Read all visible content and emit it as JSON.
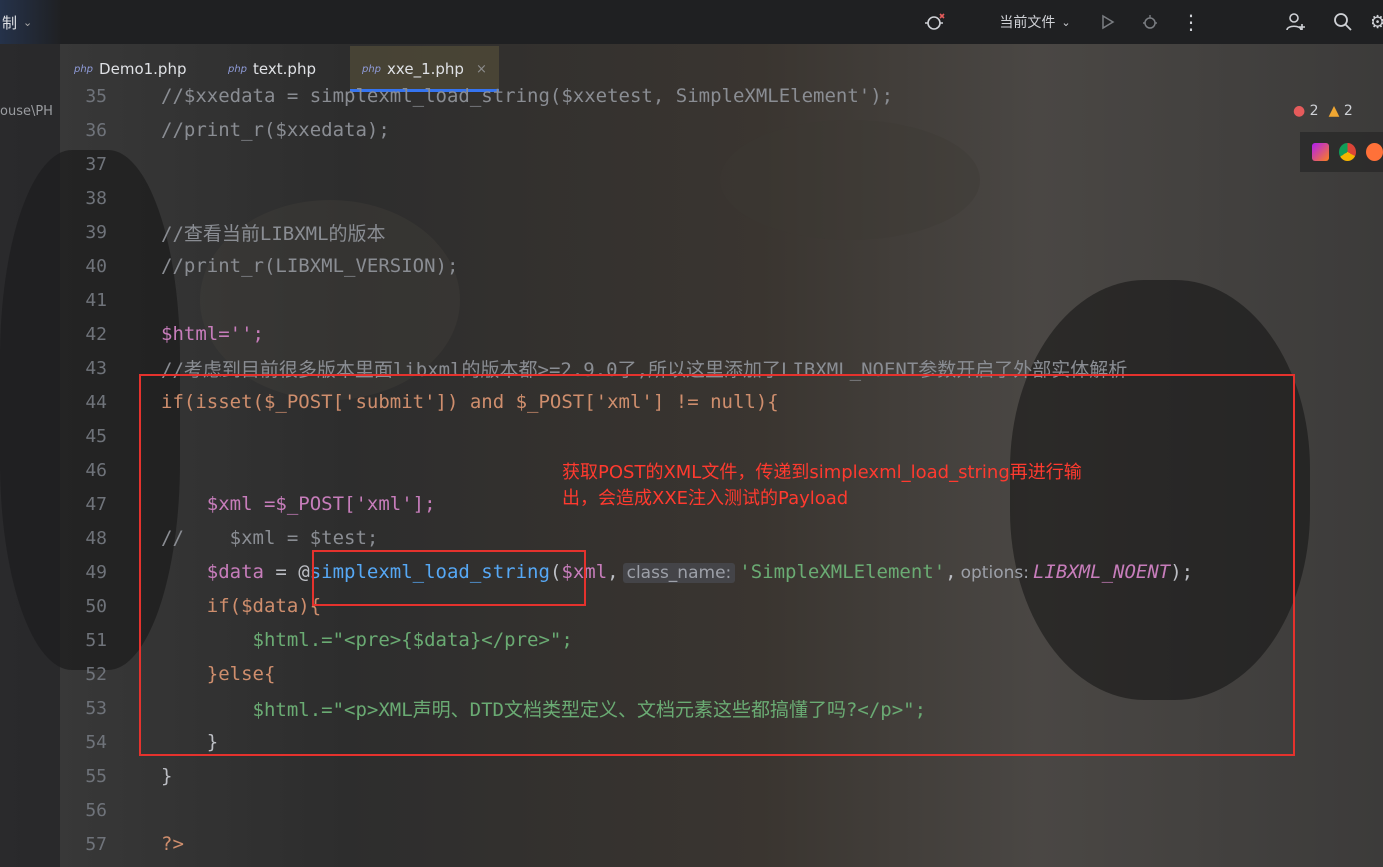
{
  "toolbar": {
    "left_label": "制",
    "run_config": "当前文件",
    "colors": {
      "bg": "#1f2022",
      "accent": "#3574f0"
    }
  },
  "tabs": [
    {
      "icon": "php",
      "label": "Demo1.php",
      "active": false
    },
    {
      "icon": "php",
      "label": "text.php",
      "active": false
    },
    {
      "icon": "php",
      "label": "xxe_1.php",
      "active": true,
      "close": "×"
    }
  ],
  "side_path": "ouse\\PH",
  "inspections": {
    "errors": "2",
    "warnings": "2"
  },
  "code_lines": [
    {
      "num": "35",
      "text": "//$xxedata = simplexml_load_string($xxetest, SimpleXMLElement');"
    },
    {
      "num": "36",
      "text": "//print_r($xxedata);"
    },
    {
      "num": "37",
      "text": ""
    },
    {
      "num": "38",
      "text": ""
    },
    {
      "num": "39",
      "text": "//查看当前LIBXML的版本"
    },
    {
      "num": "40",
      "text": "//print_r(LIBXML_VERSION);"
    },
    {
      "num": "41",
      "text": ""
    },
    {
      "num": "42",
      "text": "$html='';"
    },
    {
      "num": "43",
      "text": "//考虑到目前很多版本里面libxml的版本都>=2.9.0了,所以这里添加了LIBXML_NOENT参数开启了外部实体解析"
    },
    {
      "num": "44",
      "text": "if(isset($_POST['submit']) and $_POST['xml'] != null){"
    },
    {
      "num": "45",
      "text": ""
    },
    {
      "num": "46",
      "text": ""
    },
    {
      "num": "47",
      "text": "    $xml =$_POST['xml'];"
    },
    {
      "num": "48",
      "text": "//    $xml = $test;"
    },
    {
      "num": "49",
      "text": "    $data = @simplexml_load_string($xml, class_name: 'SimpleXMLElement', options: LIBXML_NOENT);"
    },
    {
      "num": "50",
      "text": "    if($data){"
    },
    {
      "num": "51",
      "text": "        $html.=\"<pre>{$data}</pre>\";"
    },
    {
      "num": "52",
      "text": "    }else{"
    },
    {
      "num": "53",
      "text": "        $html.=\"<p>XML声明、DTD文档类型定义、文档元素这些都搞懂了吗?</p>\";"
    },
    {
      "num": "54",
      "text": "    }"
    },
    {
      "num": "55",
      "text": "}"
    },
    {
      "num": "56",
      "text": ""
    },
    {
      "num": "57",
      "text": "?>"
    }
  ],
  "hints": {
    "class_name": "class_name:",
    "options": "options:"
  },
  "annotation": {
    "line1": "获取POST的XML文件，传递到simplexml_load_string再进行输",
    "line2": "出，会造成XXE注入测试的Payload",
    "color": "#ff3a2f"
  }
}
